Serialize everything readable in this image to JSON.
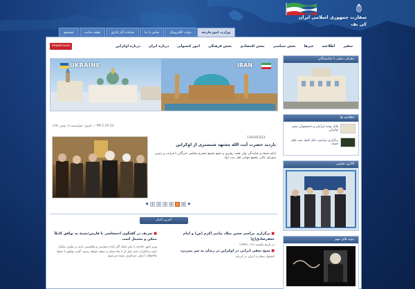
{
  "header": {
    "title_line1": "سفارت جمهوری اسلامی ایران",
    "title_line2": "کی یف"
  },
  "top_tabs": [
    {
      "label": "وزارت امورخارجه",
      "active": true
    },
    {
      "label": "دولت الکترونیک",
      "active": false
    },
    {
      "label": "تماس با ما",
      "active": false
    },
    {
      "label": "سامانه آثار اداری",
      "active": false
    },
    {
      "label": "نقشه سایت",
      "active": false
    },
    {
      "label": "جستجو",
      "active": false
    }
  ],
  "main_nav": [
    "سفیر",
    "اطلاعیه",
    "خبرها",
    "بخش سیاسی",
    "بخش اقتصادی",
    "بخش فرهنگی",
    "امور کنسولی",
    "درباره ایران",
    "درباره اوکراین"
  ],
  "language_button": "Українська",
  "banner": {
    "label_ukraine": "UKRAINE",
    "label_iran": "IRAN"
  },
  "date_line": "امروز: چهارشنبه ۱۸ بهمن ۱۳۹۲ — PM 1:25:53",
  "news": {
    "date": "1393/03/23",
    "title": "بازدید حضرت آیت الله مجتهد شبستری از اوکراین",
    "description": "امام جمعه و نمایندگی ولی‌ فقیه رهبری و جمع مجمع محترم مجلس خبرگان با قرایت و رئیس شورای عالی مجمع جهانی اهل بیت (ع)"
  },
  "pager": {
    "pages": [
      "1",
      "2",
      "3",
      "4",
      "5",
      "6"
    ],
    "active_index": 4
  },
  "latest_news": {
    "heading": "آخرین اخبار",
    "left": {
      "lead": "تعریف در گفتگوی اختصاصی با فارس:بستهٔ به توافق کاملاً ممکن و محتمل است",
      "body": "وزیر امور خارجه با بیان اینکه اگر اراده سیاسی و واقعبینی بازم در طرف مقابل باشد مذاکرات جدی قبل از ۶ ماه تمام به نتیجه خواهد رسید، گفت توافق با حفظ ملاحظات اصلی دو طرف بسته می‌شود."
    },
    "right": {
      "lead": "برگزاری مراسم جشن میلاد پیامبر اکرم (ص) و امام جعفرصادق(ع)",
      "date": "در تاریخ یکشنبه ۱۳۹۳/۱۰/۱۸",
      "lead2": "شیخ نجفی ایرانی در اوکراین در زندان به سر نمی‌برد",
      "sub2": "کنسول سفارت ایران در کی‌یف"
    }
  },
  "sidebar": {
    "ambassador_heading": "معرفی سفیر با شایستگان",
    "notices_heading": "اطلاعیه ها",
    "notices": [
      "قابل توجه ایرانیان و دانشجویان مقیم اوکراین",
      "برگزاری مراسم دعای کمیل شب های جمعه"
    ],
    "gallery_heading": "گالری تصاویر",
    "links_heading": "پیوند های مهم"
  },
  "colors": {
    "accent_orange": "#f07b1c",
    "nav_blue": "#34578a",
    "brand_red": "#c9252b"
  }
}
